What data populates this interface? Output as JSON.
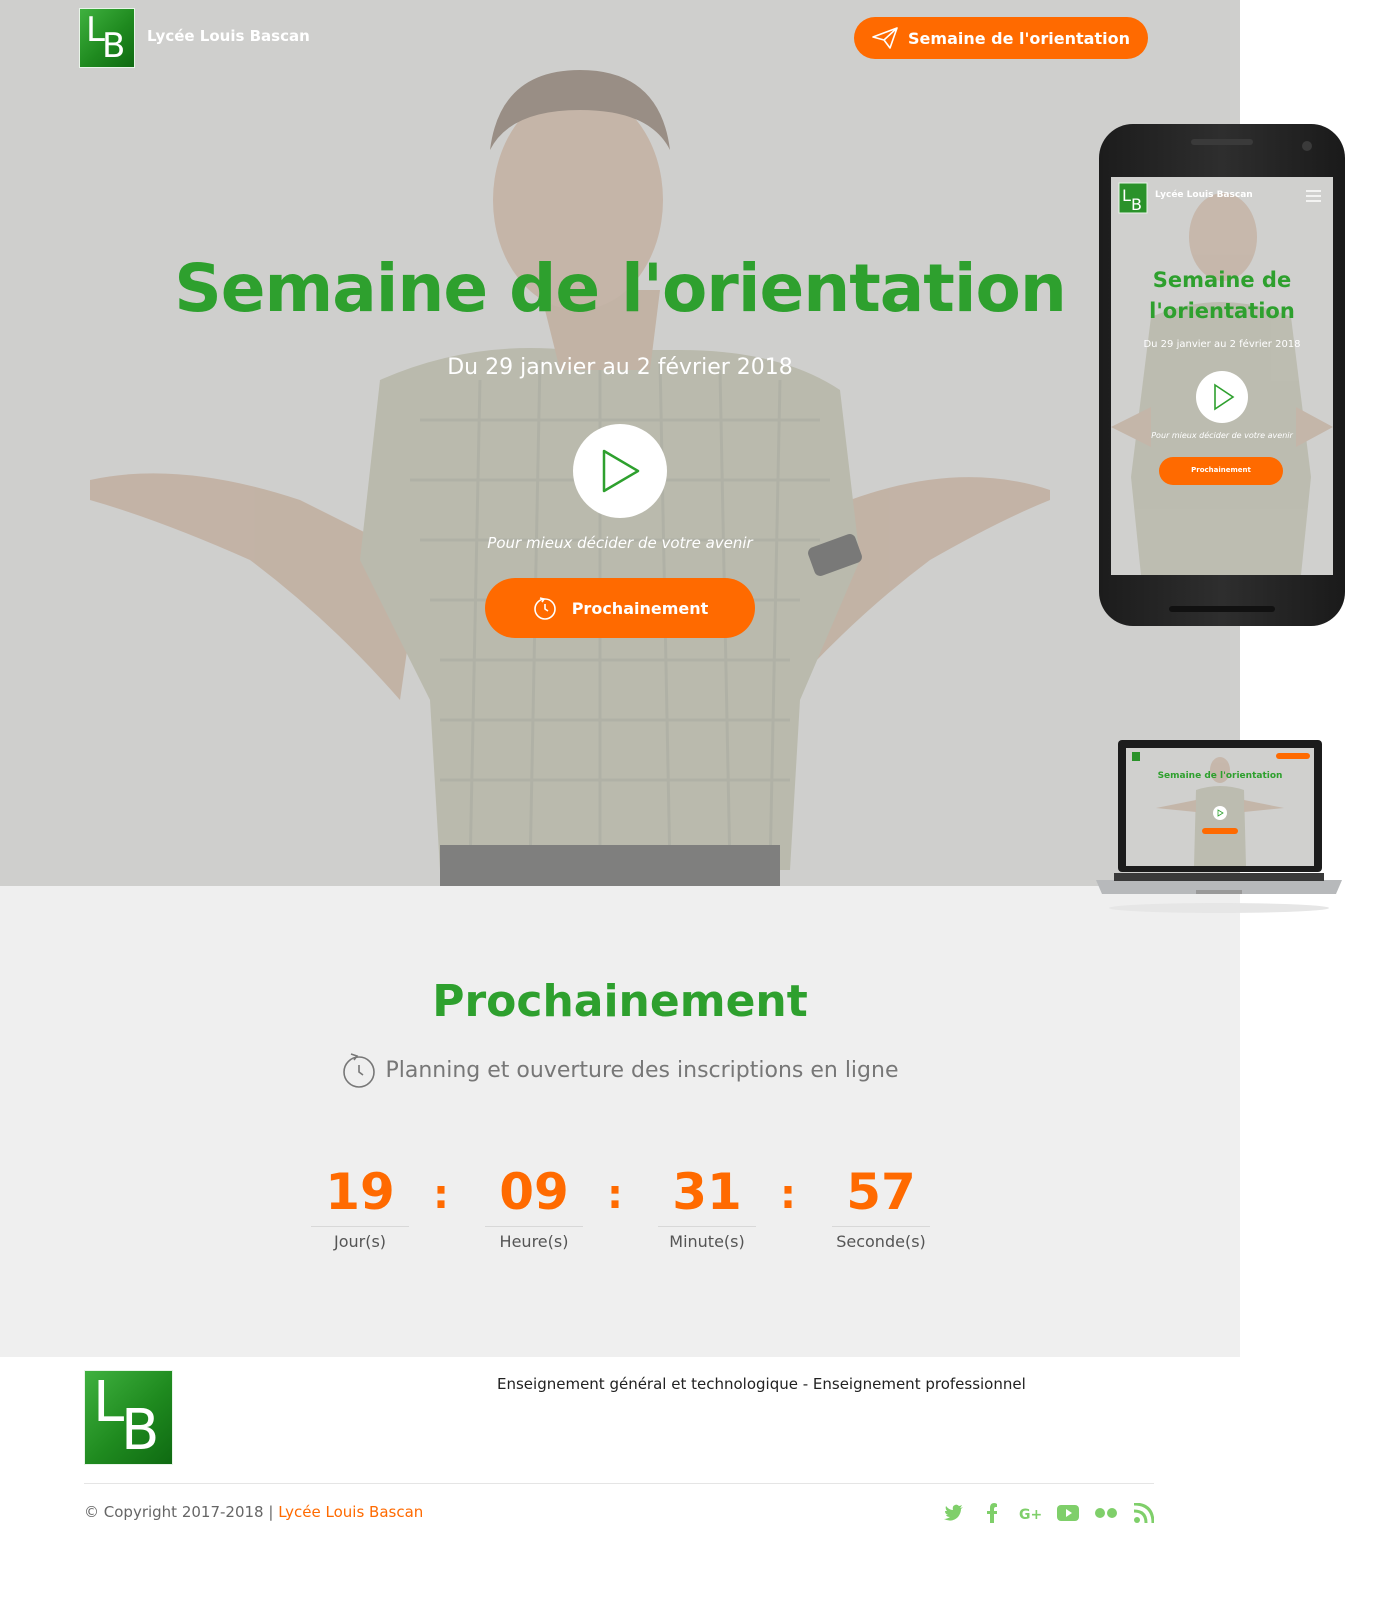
{
  "brand": {
    "name": "Lycée Louis Bascan",
    "logo_letters": [
      "L",
      "B"
    ]
  },
  "header": {
    "cta_label": "Semaine de l'orientation",
    "cta_icon": "paper-plane-icon"
  },
  "hero": {
    "title": "Semaine de l'orientation",
    "subtitle": "Du 29 janvier au 2 février 2018",
    "play_icon": "play-icon",
    "tagline": "Pour mieux décider de votre avenir",
    "button_label": "Prochainement",
    "button_icon": "timer-icon"
  },
  "phone_preview": {
    "brand": "Lycée Louis Bascan",
    "title_line1": "Semaine de",
    "title_line2": "l'orientation",
    "subtitle": "Du 29 janvier au 2 février 2018",
    "tagline": "Pour mieux décider de votre avenir",
    "button_label": "Prochainement"
  },
  "laptop_preview": {
    "title": "Semaine de l'orientation"
  },
  "countdown": {
    "title": "Prochainement",
    "subtitle": "Planning et ouverture des inscriptions en ligne",
    "units": [
      {
        "value": "19",
        "label": "Jour(s)"
      },
      {
        "value": "09",
        "label": "Heure(s)"
      },
      {
        "value": "31",
        "label": "Minute(s)"
      },
      {
        "value": "57",
        "label": "Seconde(s)"
      }
    ],
    "separator": ":"
  },
  "footer": {
    "tagline": "Enseignement général et technologique - Enseignement professionnel",
    "copyright": "© Copyright 2017-2018 |",
    "copyright_brand": "Lycée Louis Bascan",
    "social": [
      "twitter-icon",
      "facebook-icon",
      "google-plus-icon",
      "youtube-icon",
      "flickr-icon",
      "rss-icon"
    ]
  },
  "colors": {
    "green": "#2ea02e",
    "orange": "#ff6a00",
    "hero_bg": "#cfcfcd",
    "section_bg": "#efefef",
    "social": "#7fcf6a"
  }
}
